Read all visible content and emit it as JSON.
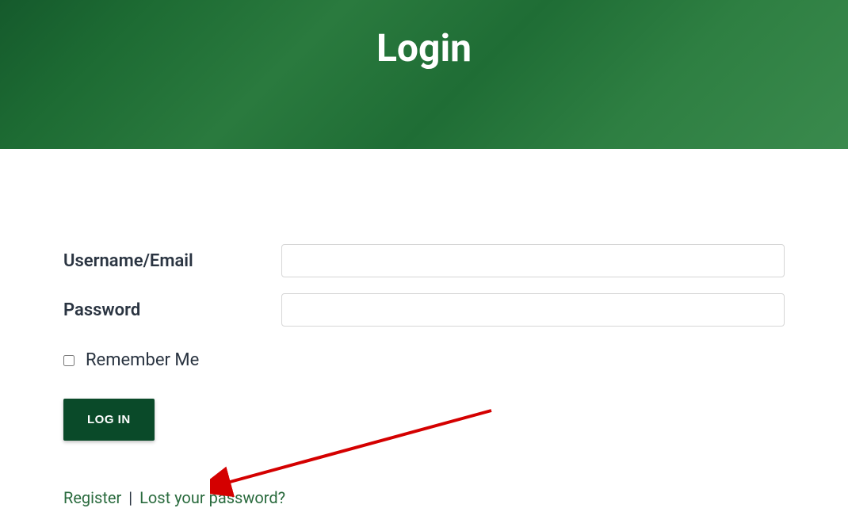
{
  "hero": {
    "title": "Login"
  },
  "form": {
    "username_label": "Username/Email",
    "password_label": "Password",
    "username_value": "",
    "password_value": "",
    "remember_label": "Remember Me",
    "submit_label": "LOG IN"
  },
  "links": {
    "register": "Register",
    "separator": "|",
    "lost_password": "Lost your password?"
  },
  "colors": {
    "hero_green": "#1d6b33",
    "button_green": "#0a4a29",
    "link_green": "#2a6b3e",
    "arrow_red": "#d40000"
  }
}
